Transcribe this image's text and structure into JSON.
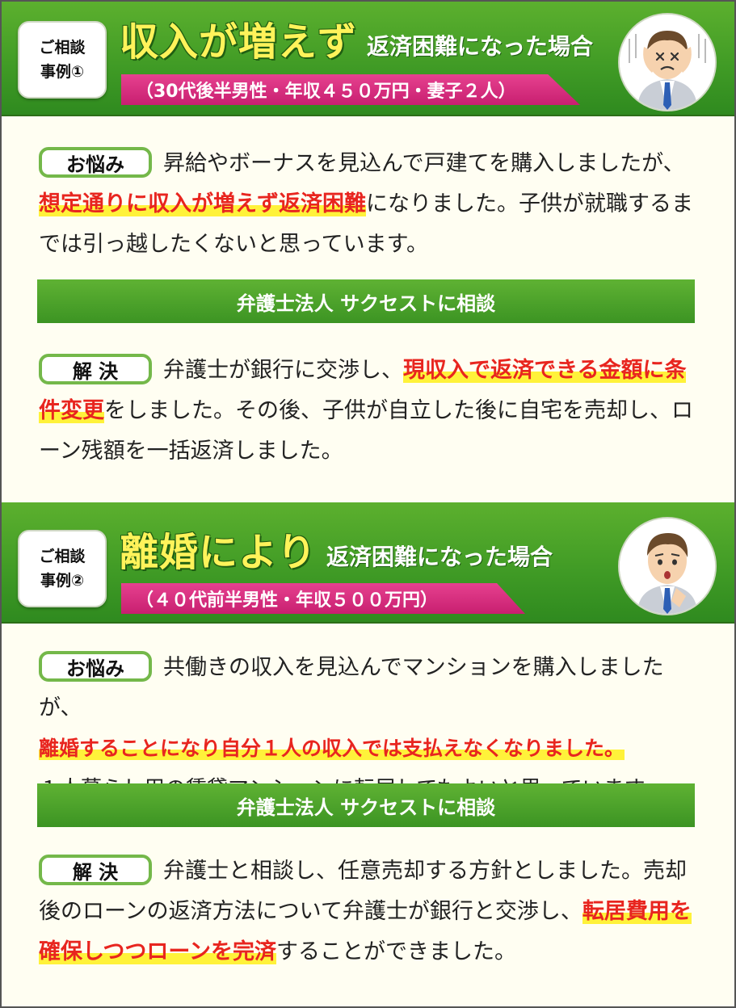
{
  "cases": [
    {
      "tag_line1": "ご相談",
      "tag_line2": "事例①",
      "headline_big": "収入が増えず",
      "headline_small": "返済困難になった場合",
      "ribbon": "（30代後半男性・年収４５０万円・妻子２人）",
      "worry_label": "お悩み",
      "worry_text1": "昇給やボーナスを見込んで戸建てを購入しましたが、",
      "worry_highlight": "想定通りに収入が増えず返済困難",
      "worry_text2": "になりました。子供が就職するまでは引っ越したくないと思っています。",
      "consult": "弁護士法人 サクセストに相談",
      "solution_label": "解 決",
      "solution_text1": "弁護士が銀行に交渉し、",
      "solution_highlight": "現収入で返済できる金額に条件変更",
      "solution_text2": "をしました。その後、子供が自立した後に自宅を売却し、ローン残額を一括返済しました。"
    },
    {
      "tag_line1": "ご相談",
      "tag_line2": "事例②",
      "headline_big": "離婚により",
      "headline_small": "返済困難になった場合",
      "ribbon": "（４０代前半男性・年収５００万円）",
      "worry_label": "お悩み",
      "worry_text1": "共働きの収入を見込んでマンションを購入しましたが、",
      "worry_highlight": "離婚することになり自分１人の収入では支払えなくなりました。",
      "worry_text2": "１人暮らし用の賃貸マンションに転居してもよいと思っています。",
      "consult": "弁護士法人 サクセストに相談",
      "solution_label": "解 決",
      "solution_text1": "弁護士と相談し、任意売却する方針としました。売却後のローンの返済方法について弁護士が銀行と交渉し、",
      "solution_highlight": "転居費用を確保しつつローンを完済",
      "solution_text2": "することができました。"
    }
  ],
  "colors": {
    "banner_green": "#3f9a25",
    "headline_yellow": "#fff35a",
    "ribbon_pink": "#d62f7f",
    "highlight_red": "#e8251f",
    "marker_yellow": "#fff23a"
  },
  "icons": [
    "distressed-man-avatar",
    "worried-man-avatar"
  ]
}
